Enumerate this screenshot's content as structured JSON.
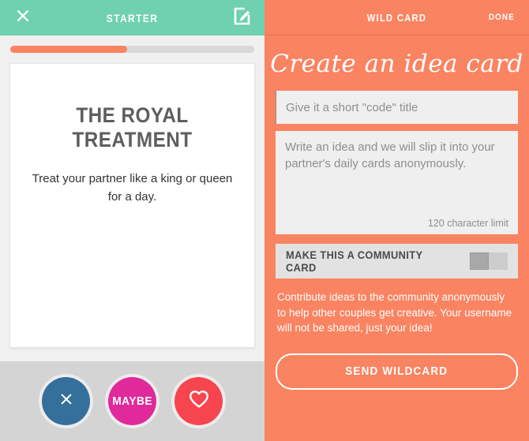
{
  "left_pane": {
    "header": {
      "close_icon": "close-x-icon",
      "title": "STARTER",
      "edit_icon": "compose-edit-icon"
    },
    "progress": {
      "percent": 48,
      "fill_color": "#FA8361",
      "track_color": "#D8D8D8"
    },
    "card": {
      "title": "THE ROYAL TREATMENT",
      "body": "Treat your partner like a king or queen for a day."
    },
    "actions": [
      {
        "name": "nope",
        "icon": "close-x-icon",
        "label": "",
        "color": "#356F9B"
      },
      {
        "name": "maybe",
        "icon": "",
        "label": "MAYBE",
        "color": "#E0299B"
      },
      {
        "name": "love",
        "icon": "heart-outline-icon",
        "label": "",
        "color": "#F7454F"
      }
    ],
    "colors": {
      "header": "#6FD1B0",
      "page_background": "#F0F0F0",
      "footer_background": "#D4D4D4"
    }
  },
  "right_pane": {
    "header": {
      "title": "WILD CARD",
      "done_label": "DONE"
    },
    "script_title": "Create an idea card",
    "code_input": {
      "value": "",
      "placeholder": "Give it a short \"code\" title"
    },
    "idea_input": {
      "value": "",
      "placeholder": "Write an idea and we will slip it into your partner's daily cards anonymously.",
      "char_limit_label": "120 character limit"
    },
    "community_toggle": {
      "label": "MAKE THIS A COMMUNITY CARD",
      "state": "off"
    },
    "helper_text": "Contribute ideas to the community anonymously to help other couples get creative. Your username will not be shared, just your idea!",
    "send_button": {
      "label": "SEND WILDCARD"
    },
    "colors": {
      "background": "#FA8361",
      "field_background": "#EFEFEF",
      "toggle_row_background": "#E2E2E2"
    }
  }
}
